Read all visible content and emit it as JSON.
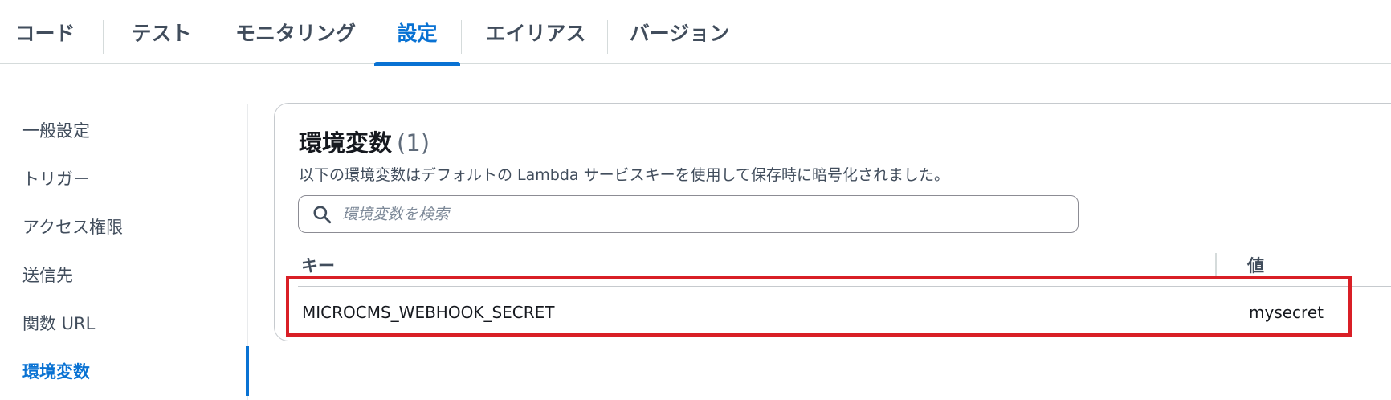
{
  "tabs": [
    {
      "label": "コード",
      "active": false
    },
    {
      "label": "テスト",
      "active": false
    },
    {
      "label": "モニタリング",
      "active": false
    },
    {
      "label": "設定",
      "active": true
    },
    {
      "label": "エイリアス",
      "active": false
    },
    {
      "label": "バージョン",
      "active": false
    }
  ],
  "sidenav": {
    "items": [
      {
        "label": "一般設定",
        "active": false
      },
      {
        "label": "トリガー",
        "active": false
      },
      {
        "label": "アクセス権限",
        "active": false
      },
      {
        "label": "送信先",
        "active": false
      },
      {
        "label": "関数 URL",
        "active": false
      },
      {
        "label": "環境変数",
        "active": true
      }
    ]
  },
  "env_panel": {
    "title": "環境変数",
    "count": "(1)",
    "description": "以下の環境変数はデフォルトの Lambda サービスキーを使用して保存時に暗号化されました。",
    "search": {
      "placeholder": "環境変数を検索",
      "value": ""
    },
    "table": {
      "columns": [
        "キー",
        "値"
      ],
      "rows": [
        {
          "key": "MICROCMS_WEBHOOK_SECRET",
          "value": "mysecret"
        }
      ]
    }
  },
  "colors": {
    "accent": "#0972d3",
    "highlight": "#d91f26",
    "text": "#16191f",
    "muted": "#414d5c"
  }
}
